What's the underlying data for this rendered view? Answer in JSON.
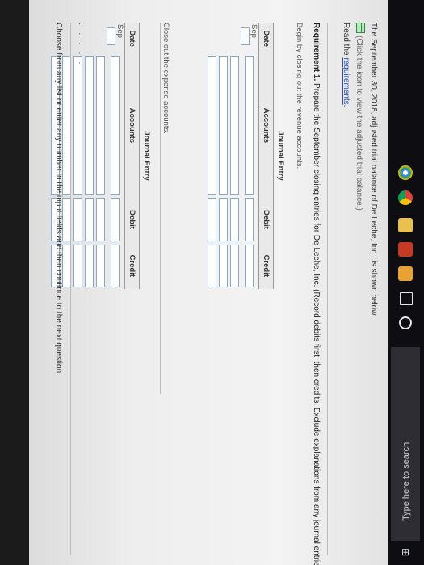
{
  "intro": {
    "line1": "The September 30, 2018, adjusted trial balance of De Leche, Inc., is shown below.",
    "line2": "(Click the icon to view the adjusted trial balance.)",
    "read_prefix": "Read the ",
    "read_link": "requirements",
    "read_suffix": "."
  },
  "requirement": {
    "label": "Requirement 1.",
    "text": " Prepare the September closing entries for De Leche, Inc. (Record debits first, then credits. Exclude explanations from any journal entries.)"
  },
  "step1": "Begin by closing out the revenue accounts.",
  "step2": "Close out the expense accounts.",
  "journal": {
    "title": "Journal Entry",
    "headers": {
      "date": "Date",
      "accounts": "Accounts",
      "debit": "Debit",
      "credit": "Credit"
    },
    "month": "Sep"
  },
  "ellipsis": "· · · · ·",
  "footer": "Choose from any list or enter any number in the input fields and then continue to the next question.",
  "taskbar": {
    "search_placeholder": "Type here to search",
    "start_icon": "windows-icon",
    "apps": [
      "cortana-icon",
      "task-view-icon",
      "store-icon",
      "office-icon",
      "file-explorer-icon",
      "chrome-icon",
      "chrome-icon"
    ]
  }
}
